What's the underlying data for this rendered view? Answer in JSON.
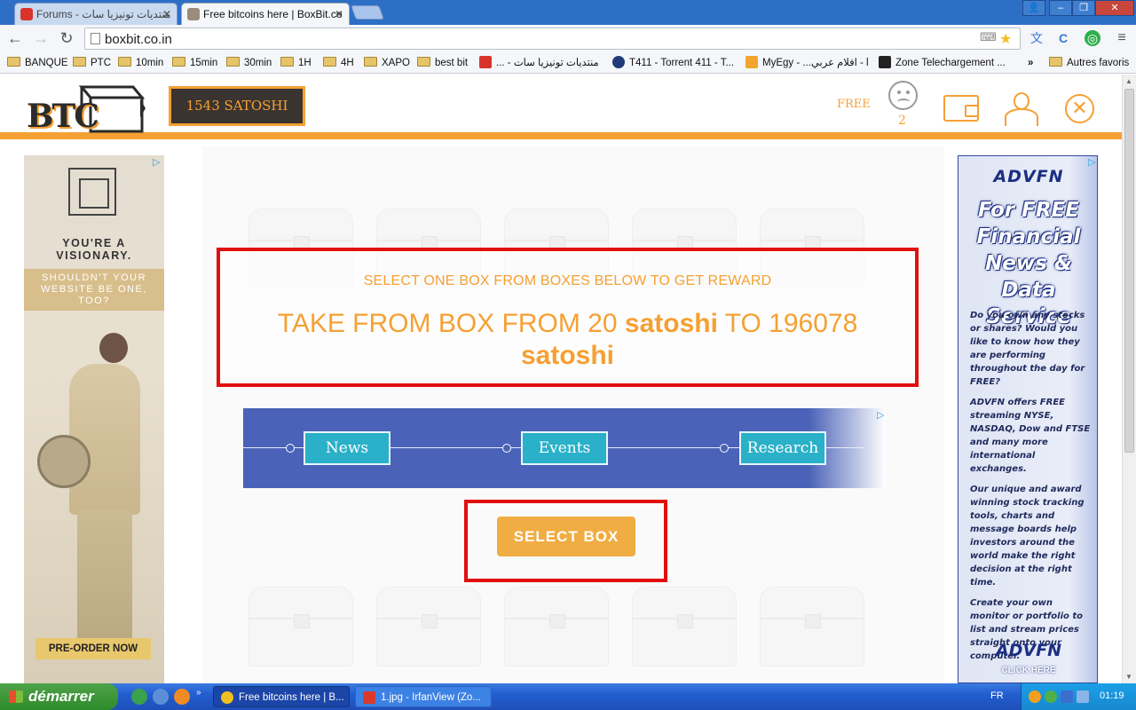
{
  "browser": {
    "tabs": [
      {
        "title": "Forums - منتديات تونيزيا سات",
        "active": false
      },
      {
        "title": "Free bitcoins here | BoxBit.co",
        "active": true
      }
    ],
    "url": "boxbit.co.in",
    "bookmarks": [
      {
        "label": "BANQUE",
        "type": "folder"
      },
      {
        "label": "PTC",
        "type": "folder"
      },
      {
        "label": "10min",
        "type": "folder"
      },
      {
        "label": "15min",
        "type": "folder"
      },
      {
        "label": "30min",
        "type": "folder"
      },
      {
        "label": "1H",
        "type": "folder"
      },
      {
        "label": "4H",
        "type": "folder"
      },
      {
        "label": "XAPO",
        "type": "folder"
      },
      {
        "label": "best bit",
        "type": "folder"
      },
      {
        "label": "... - منتديات تونيزيا سات",
        "type": "site"
      },
      {
        "label": "T411 - Torrent 411 - T...",
        "type": "site"
      },
      {
        "label": "MyEgy - ...افلام عربي - l",
        "type": "site"
      },
      {
        "label": "Zone Telechargement ...",
        "type": "site"
      }
    ],
    "bookmarks_overflow": "»",
    "other_bookmarks": "Autres favoris"
  },
  "site": {
    "logo_text": "BTC",
    "balance": "1543 SATOSHI",
    "free_label": "FREE",
    "sad_count": "2"
  },
  "main": {
    "subtitle": "SELECT ONE BOX FROM BOXES BELOW TO GET REWARD",
    "title_part1": "TAKE FROM BOX FROM 20 ",
    "title_unit1": "satoshi",
    "title_part2": " TO 196078 ",
    "title_unit2": "satoshi",
    "select_button": "SELECT BOX"
  },
  "ad_banner": {
    "tabs": [
      "News",
      "Events",
      "Research"
    ]
  },
  "left_ad": {
    "tagline": "YOU'RE A VISIONARY.",
    "tagline2": "SHOULDN'T YOUR WEBSITE BE ONE, TOO?",
    "cta": "PRE-ORDER NOW"
  },
  "right_ad": {
    "brand": "ADVFN",
    "headline": "For FREE Financial News & Data Service",
    "paragraphs": [
      "Do you own any stocks or shares? Would you like to know how they are performing throughout the day for FREE?",
      "ADVFN offers FREE streaming NYSE, NASDAQ, Dow and FTSE and many more international exchanges.",
      "Our unique and award winning stock tracking tools, charts and message boards help investors around the world make the right decision at the right time.",
      "Create your own monitor or portfolio to list and stream prices straight onto your computer."
    ],
    "cta": "CLICK HERE"
  },
  "taskbar": {
    "start": "démarrer",
    "tasks": [
      "Free bitcoins here | B...",
      "1.jpg - IrfanView (Zo..."
    ],
    "language": "FR",
    "clock": "01:19"
  },
  "colors": {
    "accent": "#f5a033",
    "highlight": "#e20f0f",
    "banner": "#4a62b8",
    "banner_tab": "#2ab0c8"
  }
}
